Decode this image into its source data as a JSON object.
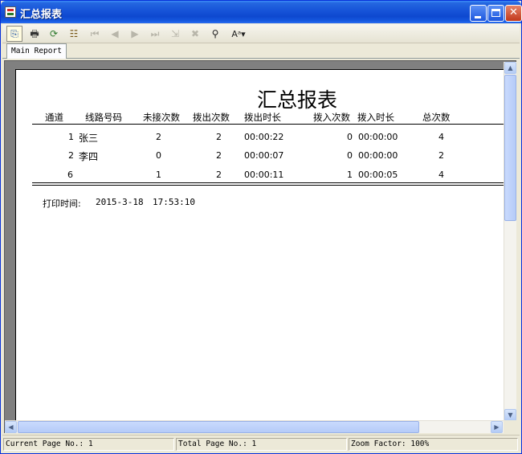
{
  "window": {
    "title": "汇总报表",
    "minimize_glyph": "",
    "close_glyph": "✕"
  },
  "toolbar": {
    "icons": [
      "export-icon",
      "print-icon",
      "refresh-icon",
      "group-tree-icon",
      "first-page-icon",
      "previous-page-icon",
      "next-page-icon",
      "last-page-icon",
      "goto-page-icon",
      "stop-icon",
      "find-icon",
      "zoom-icon"
    ],
    "glyphs": [
      "⎘",
      "🖶",
      "⟳",
      "☷",
      "⏮",
      "◀",
      "▶",
      "⏭",
      "⇲",
      "✖",
      "⚲",
      "Aᵃ▾"
    ]
  },
  "tabs": {
    "main": "Main Report"
  },
  "report": {
    "title": "汇总报表",
    "headers": [
      "通道",
      "线路号码",
      "未接次数",
      "拨出次数",
      "拨出时长",
      "拨入次数",
      "拨入时长",
      "总次数"
    ],
    "rows": [
      [
        "1",
        "张三",
        "2",
        "2",
        "00:00:22",
        "0",
        "00:00:00",
        "4"
      ],
      [
        "2",
        "李四",
        "0",
        "2",
        "00:00:07",
        "0",
        "00:00:00",
        "2"
      ]
    ],
    "total": [
      "6",
      "",
      "1",
      "2",
      "00:00:11",
      "1",
      "00:00:05",
      "4"
    ],
    "print_label": "打印时间:",
    "print_date": "2015-3-18",
    "print_time": "17:53:10"
  },
  "status": {
    "current_page": "Current Page No.: 1",
    "total_page": "Total Page No.: 1",
    "zoom": "Zoom Factor: 100%"
  },
  "colors": {
    "title_bar": "#0e48cf",
    "close_button": "#c2391b",
    "report_background": "#808080"
  }
}
